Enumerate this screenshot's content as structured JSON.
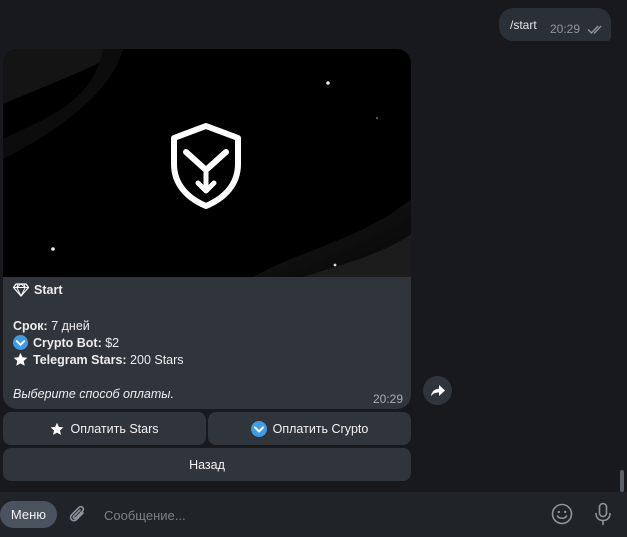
{
  "outgoing": {
    "text": "/start",
    "time": "20:29"
  },
  "message": {
    "title": "Start",
    "term_label": "Срок:",
    "term_value": "7 дней",
    "crypto_label": "Crypto Bot:",
    "crypto_value": "$2",
    "stars_label": "Telegram Stars:",
    "stars_value": "200 Stars",
    "prompt": "Выберите способ оплаты.",
    "time": "20:29"
  },
  "keyboard": {
    "pay_stars": "Оплатить Stars",
    "pay_crypto": "Оплатить Crypto",
    "back": "Назад"
  },
  "composer": {
    "menu_label": "Меню",
    "placeholder": "Сообщение..."
  },
  "icons": {
    "title": "diamond-icon",
    "crypto": "crypto-bot-icon",
    "stars": "star-icon",
    "banner": "shield-download-icon",
    "share": "share-arrow-icon",
    "attach": "paperclip-icon",
    "emoji": "emoji-icon",
    "voice": "microphone-icon"
  },
  "colors": {
    "background": "#17191d",
    "bubble": "#30353b",
    "accent": "#5aa8e6"
  }
}
